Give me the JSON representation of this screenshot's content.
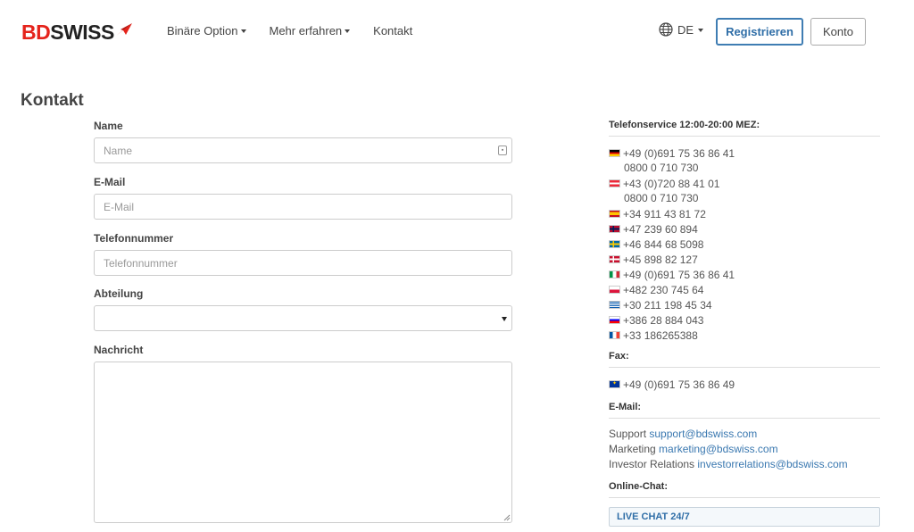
{
  "header": {
    "logo": {
      "part1": "BD",
      "part2": "SWISS"
    },
    "nav": [
      {
        "label": "Binäre Option",
        "has_caret": true
      },
      {
        "label": "Mehr erfahren",
        "has_caret": true
      },
      {
        "label": "Kontakt",
        "has_caret": false
      }
    ],
    "language": "DE",
    "register_label": "Registrieren",
    "account_label": "Konto"
  },
  "page": {
    "title": "Kontakt"
  },
  "form": {
    "name": {
      "label": "Name",
      "placeholder": "Name"
    },
    "email": {
      "label": "E-Mail",
      "placeholder": "E-Mail"
    },
    "phone": {
      "label": "Telefonnummer",
      "placeholder": "Telefonnummer"
    },
    "department": {
      "label": "Abteilung",
      "value": ""
    },
    "message": {
      "label": "Nachricht",
      "value": ""
    }
  },
  "info": {
    "phone_heading": "Telefonservice 12:00-20:00 MEZ:",
    "phones": [
      {
        "flag": "de",
        "number": "+49 (0)691 75 36 86 41",
        "sub": "0800 0 710 730"
      },
      {
        "flag": "at",
        "number": "+43 (0)720 88 41 01",
        "sub": "0800 0 710 730"
      },
      {
        "flag": "es",
        "number": "+34 911 43 81 72"
      },
      {
        "flag": "no",
        "number": "+47 239 60 894"
      },
      {
        "flag": "se",
        "number": "+46 844 68 5098"
      },
      {
        "flag": "dk",
        "number": "+45 898 82 127"
      },
      {
        "flag": "it",
        "number": "+49 (0)691 75 36 86 41"
      },
      {
        "flag": "pl",
        "number": "+482 230 745 64"
      },
      {
        "flag": "gr",
        "number": "+30 211 198 45 34"
      },
      {
        "flag": "si",
        "number": "+386 28 884 043"
      },
      {
        "flag": "fr",
        "number": "+33 186265388"
      }
    ],
    "fax_heading": "Fax:",
    "fax": {
      "flag": "eu",
      "number": "+49 (0)691 75 36 86 49"
    },
    "email_heading": "E-Mail:",
    "emails": [
      {
        "label": "Support",
        "address": "support@bdswiss.com"
      },
      {
        "label": "Marketing",
        "address": "marketing@bdswiss.com"
      },
      {
        "label": "Investor Relations",
        "address": "investorrelations@bdswiss.com"
      }
    ],
    "chat_heading": "Online-Chat:",
    "chat_button": "LIVE CHAT 24/7"
  },
  "colors": {
    "brand_red": "#e5231b",
    "link_blue": "#3a78b0",
    "register_border": "#3f7db3"
  }
}
